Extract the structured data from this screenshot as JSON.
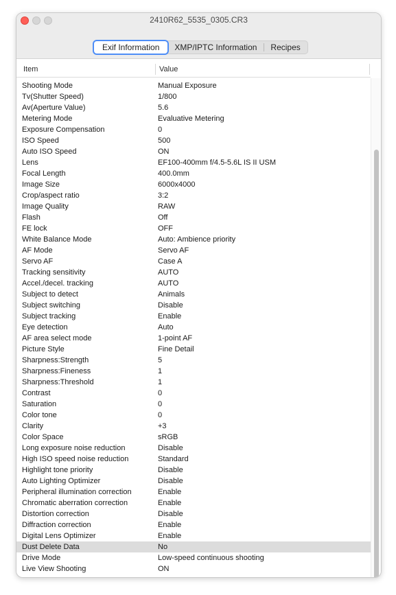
{
  "window": {
    "title": "2410R62_5535_0305.CR3"
  },
  "tabs": [
    {
      "label": "Exif Information",
      "active": true
    },
    {
      "label": "XMP/IPTC Information",
      "active": false
    },
    {
      "label": "Recipes",
      "active": false
    }
  ],
  "table": {
    "columns": {
      "item": "Item",
      "value": "Value"
    },
    "selected_row": "Dust Delete Data",
    "rows": [
      {
        "item": "Shooting Mode",
        "value": "Manual Exposure"
      },
      {
        "item": "Tv(Shutter Speed)",
        "value": "1/800"
      },
      {
        "item": "Av(Aperture Value)",
        "value": "5.6"
      },
      {
        "item": "Metering Mode",
        "value": "Evaluative Metering"
      },
      {
        "item": "Exposure Compensation",
        "value": "0"
      },
      {
        "item": "ISO Speed",
        "value": "500"
      },
      {
        "item": "Auto ISO Speed",
        "value": "ON"
      },
      {
        "item": "Lens",
        "value": "EF100-400mm f/4.5-5.6L IS II USM"
      },
      {
        "item": "Focal Length",
        "value": "400.0mm"
      },
      {
        "item": "Image Size",
        "value": "6000x4000"
      },
      {
        "item": "Crop/aspect ratio",
        "value": "3:2"
      },
      {
        "item": "Image Quality",
        "value": "RAW"
      },
      {
        "item": "Flash",
        "value": "Off"
      },
      {
        "item": "FE lock",
        "value": "OFF"
      },
      {
        "item": "White Balance Mode",
        "value": "Auto: Ambience priority"
      },
      {
        "item": "AF Mode",
        "value": "Servo AF"
      },
      {
        "item": "Servo AF",
        "value": "Case A"
      },
      {
        "item": "Tracking sensitivity",
        "value": "AUTO"
      },
      {
        "item": "Accel./decel. tracking",
        "value": "AUTO"
      },
      {
        "item": "Subject to detect",
        "value": "Animals"
      },
      {
        "item": "Subject switching",
        "value": "Disable"
      },
      {
        "item": "Subject tracking",
        "value": "Enable"
      },
      {
        "item": "Eye detection",
        "value": "Auto"
      },
      {
        "item": "AF area select mode",
        "value": "1-point AF"
      },
      {
        "item": "Picture Style",
        "value": "Fine Detail"
      },
      {
        "item": "Sharpness:Strength",
        "value": "5"
      },
      {
        "item": "Sharpness:Fineness",
        "value": "1"
      },
      {
        "item": "Sharpness:Threshold",
        "value": "1"
      },
      {
        "item": "Contrast",
        "value": "0"
      },
      {
        "item": "Saturation",
        "value": "0"
      },
      {
        "item": "Color tone",
        "value": "0"
      },
      {
        "item": "Clarity",
        "value": "+3"
      },
      {
        "item": "Color Space",
        "value": "sRGB"
      },
      {
        "item": "Long exposure noise reduction",
        "value": "Disable"
      },
      {
        "item": "High ISO speed noise reduction",
        "value": "Standard"
      },
      {
        "item": "Highlight tone priority",
        "value": "Disable"
      },
      {
        "item": "Auto Lighting Optimizer",
        "value": "Disable"
      },
      {
        "item": "Peripheral illumination correction",
        "value": "Enable"
      },
      {
        "item": "Chromatic aberration correction",
        "value": "Enable"
      },
      {
        "item": "Distortion correction",
        "value": "Disable"
      },
      {
        "item": "Diffraction correction",
        "value": "Enable"
      },
      {
        "item": "Digital Lens Optimizer",
        "value": "Enable"
      },
      {
        "item": "Dust Delete Data",
        "value": "No"
      },
      {
        "item": "Drive Mode",
        "value": "Low-speed continuous shooting"
      },
      {
        "item": "Live View Shooting",
        "value": "ON"
      }
    ]
  },
  "colors": {
    "accent": "#4d8df7",
    "close": "#fe5f57",
    "selected_row": "#dcdcdc"
  }
}
